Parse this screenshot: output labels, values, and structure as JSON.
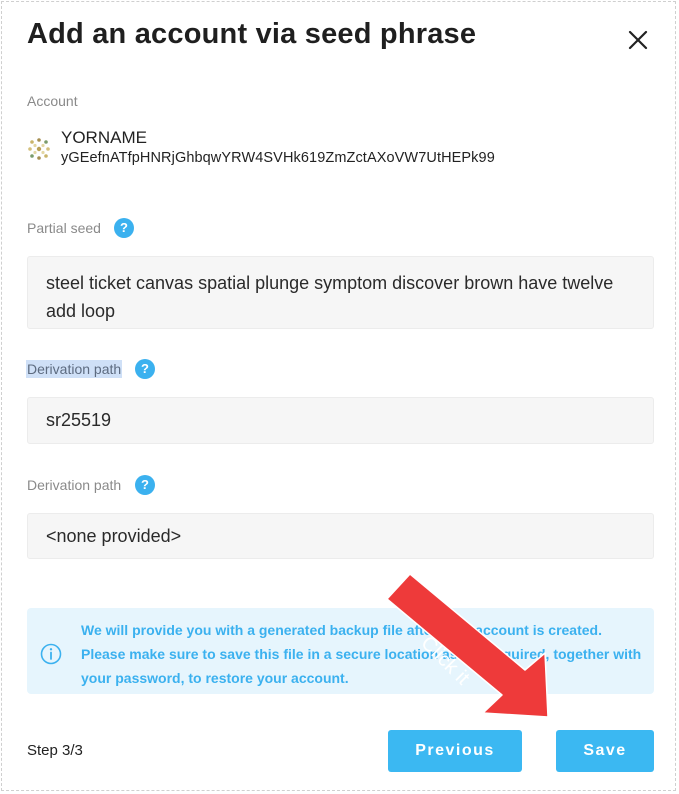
{
  "header": {
    "title": "Add an account via seed phrase"
  },
  "account": {
    "label": "Account",
    "name": "YORNAME",
    "address": "yGEefnATfpHNRjGhbqwYRW4SVHk619ZmZctAXoVW7UtHEPk99"
  },
  "partial_seed": {
    "label": "Partial seed",
    "value": "steel ticket canvas spatial plunge symptom discover brown have twelve add loop"
  },
  "derivation_1": {
    "label": "Derivation path",
    "value": "sr25519"
  },
  "derivation_2": {
    "label": "Derivation path",
    "value": "<none provided>"
  },
  "info": {
    "line1": "We will provide you with a generated backup file after your account is created.",
    "line2": "Please make sure to save this file in a secure location as it is required, together with",
    "line3": "your password, to restore your account."
  },
  "footer": {
    "step": "Step 3/3",
    "previous_label": "Previous",
    "save_label": "Save"
  },
  "annotation": {
    "text": "Click it"
  },
  "colors": {
    "accent": "#3bb8f2",
    "info_bg": "#e6f5fd",
    "arrow": "#ee3a3a"
  }
}
